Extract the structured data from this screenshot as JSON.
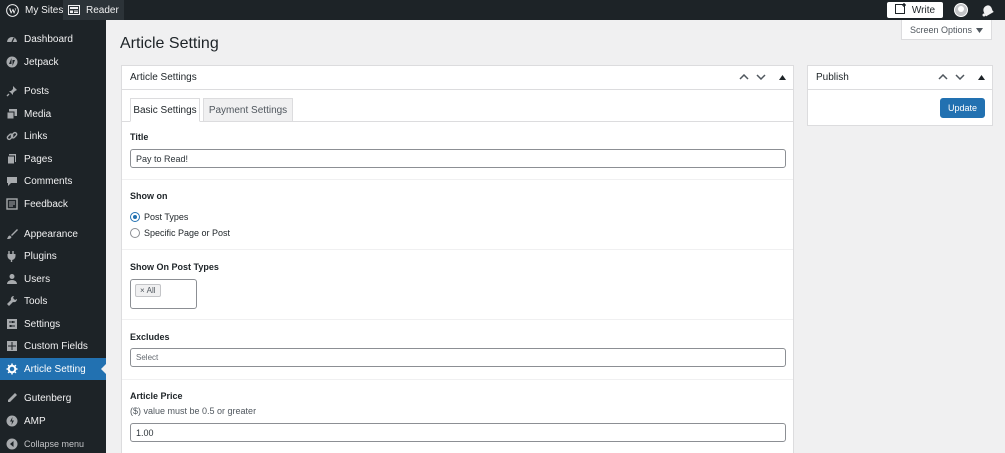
{
  "admin_bar": {
    "my_sites": "My Sites",
    "reader": "Reader",
    "write": "Write"
  },
  "sidebar": {
    "items": [
      {
        "label": "Dashboard",
        "icon": "dashboard-icon"
      },
      {
        "label": "Jetpack",
        "icon": "jetpack-icon"
      },
      {
        "label": "Posts",
        "icon": "pin-icon"
      },
      {
        "label": "Media",
        "icon": "media-icon"
      },
      {
        "label": "Links",
        "icon": "link-icon"
      },
      {
        "label": "Pages",
        "icon": "pages-icon"
      },
      {
        "label": "Comments",
        "icon": "comment-icon"
      },
      {
        "label": "Feedback",
        "icon": "feedback-icon"
      },
      {
        "label": "Appearance",
        "icon": "brush-icon"
      },
      {
        "label": "Plugins",
        "icon": "plugin-icon"
      },
      {
        "label": "Users",
        "icon": "users-icon"
      },
      {
        "label": "Tools",
        "icon": "wrench-icon"
      },
      {
        "label": "Settings",
        "icon": "settings-icon"
      },
      {
        "label": "Custom Fields",
        "icon": "custom-fields-icon"
      },
      {
        "label": "Article Setting",
        "icon": "gear-icon",
        "active": true
      },
      {
        "label": "Gutenberg",
        "icon": "pencil-icon"
      },
      {
        "label": "AMP",
        "icon": "amp-icon"
      },
      {
        "label": "Collapse menu",
        "icon": "collapse-icon"
      }
    ]
  },
  "page": {
    "title": "Article Setting",
    "screen_options": "Screen Options"
  },
  "article_box": {
    "title": "Article Settings",
    "tabs": [
      {
        "label": "Basic Settings",
        "active": true
      },
      {
        "label": "Payment Settings",
        "active": false
      }
    ],
    "fields": {
      "title_label": "Title",
      "title_value": "Pay to Read!",
      "show_on_label": "Show on",
      "show_on_options": [
        {
          "label": "Post Types",
          "checked": true
        },
        {
          "label": "Specific Page or Post",
          "checked": false
        }
      ],
      "post_types_label": "Show On Post Types",
      "post_types_selected": "All",
      "post_types_remove": "×",
      "excludes_label": "Excludes",
      "excludes_placeholder": "Select",
      "price_label": "Article Price",
      "price_desc": "($) value must be 0.5 or greater",
      "price_value": "1.00"
    }
  },
  "publish_box": {
    "title": "Publish",
    "update": "Update"
  },
  "colors": {
    "admin_bar": "#1d2327",
    "accent": "#2271b1",
    "background": "#f0f0f1"
  }
}
